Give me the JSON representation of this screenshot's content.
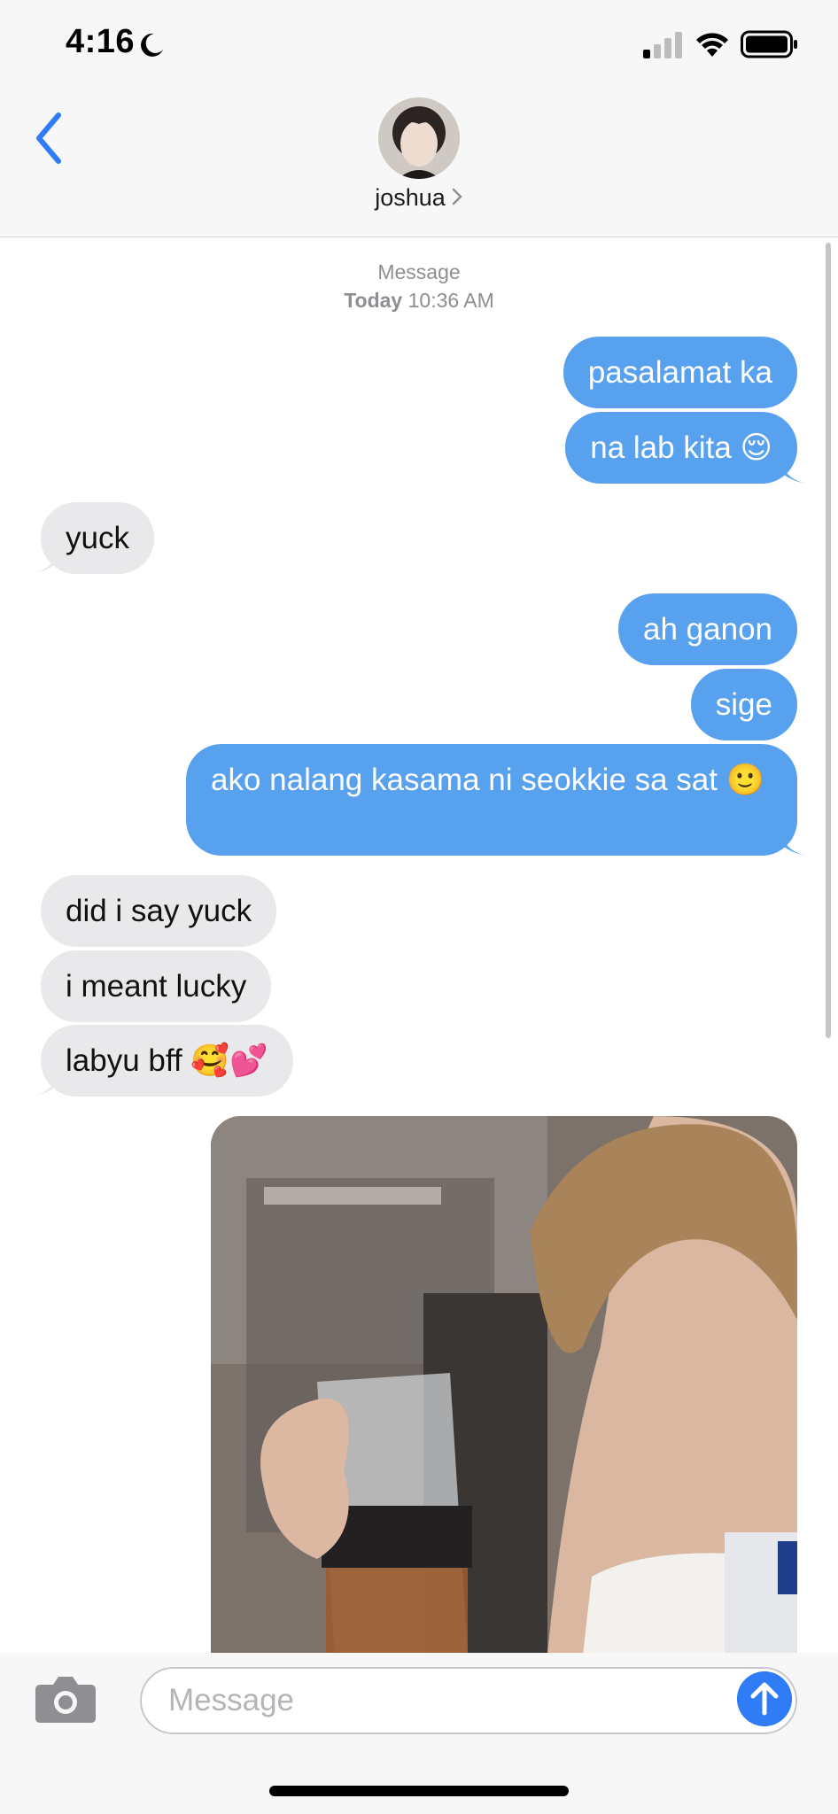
{
  "status_bar": {
    "time": "4:16",
    "icons": [
      "moon-icon",
      "signal-icon",
      "wifi-icon",
      "battery-icon"
    ]
  },
  "header": {
    "back_icon": "chevron-left-icon",
    "contact_name": "joshua",
    "contact_chevron": "›"
  },
  "conversation": {
    "timestamp": {
      "service": "Message",
      "day": "Today",
      "time": "10:36 AM"
    },
    "messages": [
      {
        "from": "me",
        "text": "pasalamat ka"
      },
      {
        "from": "me",
        "text": "na lab kita 😌"
      },
      {
        "from": "them",
        "text": "yuck"
      },
      {
        "from": "me",
        "text": "ah ganon"
      },
      {
        "from": "me",
        "text": "sige"
      },
      {
        "from": "me",
        "text": "ako nalang kasama ni seokkie sa sat 🙂"
      },
      {
        "from": "them",
        "text": "did i say yuck"
      },
      {
        "from": "them",
        "text": "i meant lucky"
      },
      {
        "from": "them",
        "text": "labyu bff 🥰💕"
      },
      {
        "from": "me",
        "type": "photo"
      }
    ]
  },
  "composer": {
    "placeholder": "Message",
    "camera_icon": "camera-icon",
    "send_icon": "arrow-up-icon"
  },
  "colors": {
    "sent_bubble": "#57a1ee",
    "received_bubble": "#e9e9eb",
    "accent": "#2f7cf6",
    "bar_bg": "#f7f7f7"
  }
}
